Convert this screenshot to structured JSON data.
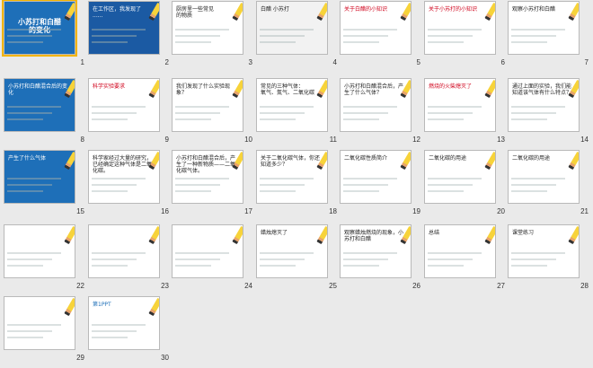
{
  "slides": [
    {
      "num": "1",
      "title": "小苏打和白醋\n的变化",
      "bg": "#1e6fb8",
      "fg": "#ffffff",
      "selected": true
    },
    {
      "num": "2",
      "title": "在工作区，我发现了\n......",
      "bg": "#1b5aa3",
      "fg": "#ffffff"
    },
    {
      "num": "3",
      "title": "厨房里一些常见\n的物质",
      "bg": "#ffffff",
      "fg": "#222222"
    },
    {
      "num": "4",
      "title": "白醋   小苏打",
      "bg": "#f2f2f2",
      "fg": "#222222"
    },
    {
      "num": "5",
      "title": "关于白醋的小知识",
      "bg": "#ffffff",
      "fg": "#d0021b"
    },
    {
      "num": "6",
      "title": "关于小苏打的小知识",
      "bg": "#ffffff",
      "fg": "#d0021b"
    },
    {
      "num": "7",
      "title": "观察小苏打和白醋",
      "bg": "#ffffff",
      "fg": "#222222"
    },
    {
      "num": "8",
      "title": "小苏打和白醋混合后的变化",
      "bg": "#1e6fb8",
      "fg": "#ffffff"
    },
    {
      "num": "9",
      "title": "科学实验要求",
      "bg": "#ffffff",
      "fg": "#d0021b"
    },
    {
      "num": "10",
      "title": "我们发现了什么实验现象？",
      "bg": "#ffffff",
      "fg": "#222222"
    },
    {
      "num": "11",
      "title": "常见的三种气体：\n氧气、氮气、二氧化碳",
      "bg": "#ffffff",
      "fg": "#222222"
    },
    {
      "num": "12",
      "title": "小苏打和白醋混合后，产生了什么气体？",
      "bg": "#ffffff",
      "fg": "#222222"
    },
    {
      "num": "13",
      "title": "燃烧的火柴熄灭了",
      "bg": "#ffffff",
      "fg": "#d0021b"
    },
    {
      "num": "14",
      "title": "通过上面的实验，我们能知道该气体有什么特点？",
      "bg": "#ffffff",
      "fg": "#222222"
    },
    {
      "num": "15",
      "title": "产生了什么气体",
      "bg": "#1e6fb8",
      "fg": "#ffffff"
    },
    {
      "num": "16",
      "title": "科学家经过大量的研究，已经确定这种气体是二氧化碳。",
      "bg": "#ffffff",
      "fg": "#222222"
    },
    {
      "num": "17",
      "title": "小苏打和白醋混合后，产生了一种新物质——二氧化碳气体。",
      "bg": "#ffffff",
      "fg": "#222222"
    },
    {
      "num": "18",
      "title": "关于二氧化碳气体，你还知道多少？",
      "bg": "#ffffff",
      "fg": "#222222"
    },
    {
      "num": "19",
      "title": "二氧化碳性质简介",
      "bg": "#ffffff",
      "fg": "#222222"
    },
    {
      "num": "20",
      "title": "二氧化碳的用途",
      "bg": "#ffffff",
      "fg": "#222222"
    },
    {
      "num": "21",
      "title": "二氧化碳的用途",
      "bg": "#ffffff",
      "fg": "#222222"
    },
    {
      "num": "22",
      "title": "",
      "bg": "#ffffff",
      "fg": "#222222"
    },
    {
      "num": "23",
      "title": "",
      "bg": "#ffffff",
      "fg": "#222222"
    },
    {
      "num": "24",
      "title": "",
      "bg": "#ffffff",
      "fg": "#222222"
    },
    {
      "num": "25",
      "title": "蜡烛熄灭了",
      "bg": "#ffffff",
      "fg": "#222222"
    },
    {
      "num": "26",
      "title": "观察蜡烛燃烧的现象，小苏打和白醋",
      "bg": "#ffffff",
      "fg": "#222222"
    },
    {
      "num": "27",
      "title": "总结",
      "bg": "#ffffff",
      "fg": "#222222"
    },
    {
      "num": "28",
      "title": "课堂练习",
      "bg": "#ffffff",
      "fg": "#222222"
    },
    {
      "num": "29",
      "title": "",
      "bg": "#ffffff",
      "fg": "#222222"
    },
    {
      "num": "30",
      "title": "第1PPT",
      "bg": "#ffffff",
      "fg": "#1e6fb8"
    }
  ],
  "colors": {
    "selection": "#f2b400",
    "accent_blue": "#1e6fb8",
    "accent_red": "#d0021b",
    "panel": "#eaeaea"
  }
}
